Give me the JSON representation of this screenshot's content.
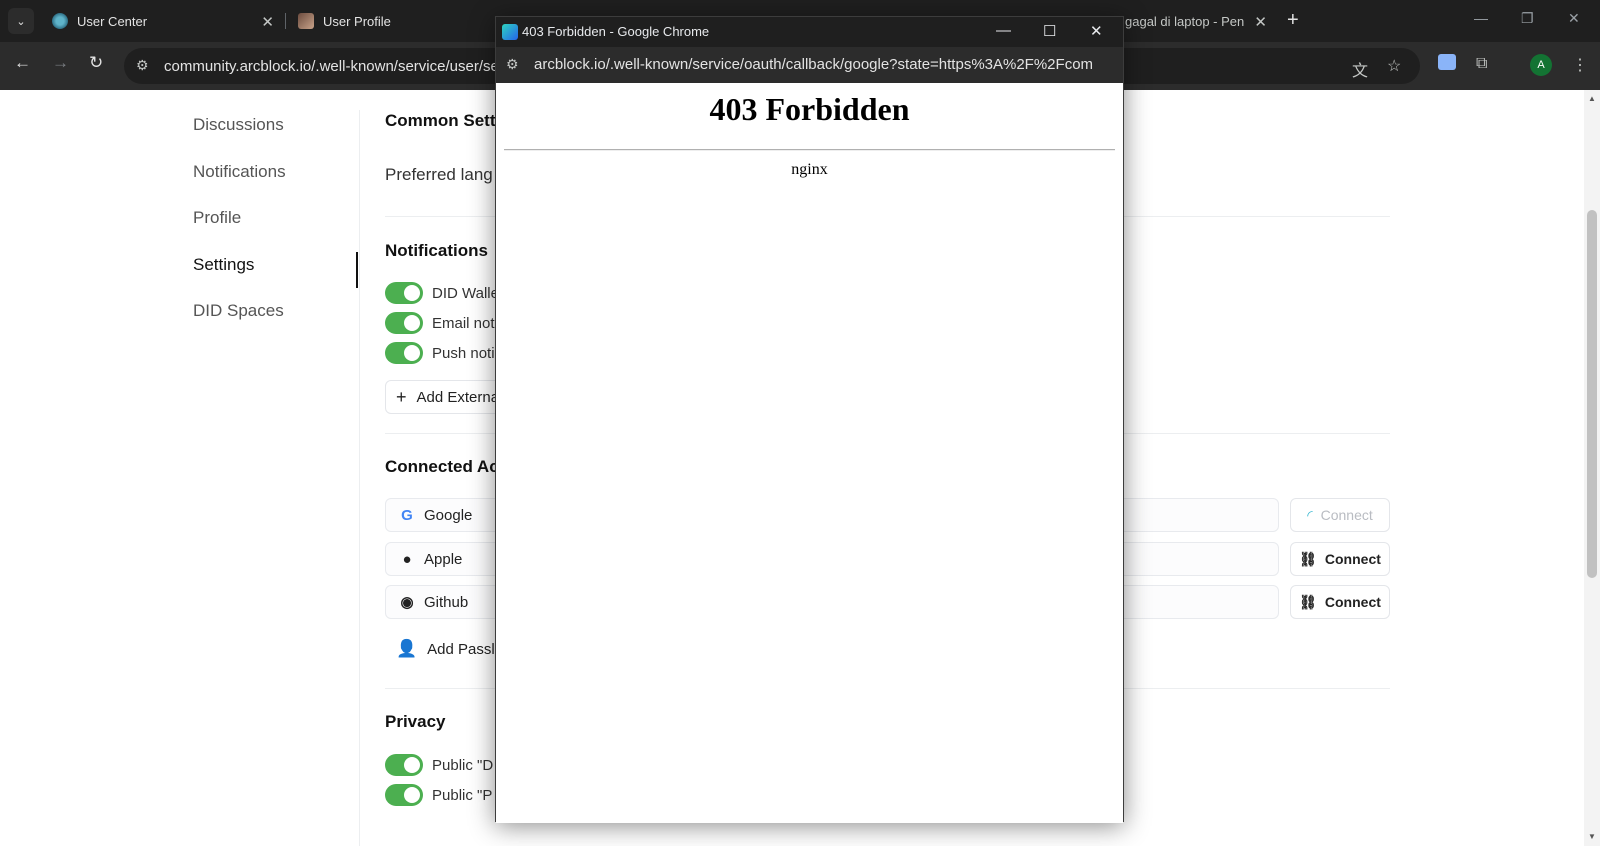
{
  "browser": {
    "tabs": [
      {
        "title": "User Center"
      },
      {
        "title": "User Profile"
      },
      {
        "title": "gagal di laptop - Pen"
      }
    ],
    "address_url": "community.arcblock.io/.well-known/service/user/se",
    "avatar_letter": "A"
  },
  "sidebar": {
    "items": [
      {
        "label": "Discussions"
      },
      {
        "label": "Notifications"
      },
      {
        "label": "Profile"
      },
      {
        "label": "Settings"
      },
      {
        "label": "DID Spaces"
      }
    ],
    "active": "Settings"
  },
  "settings": {
    "common_title": "Common Sett",
    "preferred_language": "Preferred lang",
    "notifications_title": "Notifications",
    "notification_toggles": [
      {
        "label": "DID Walle",
        "on": true
      },
      {
        "label": "Email not",
        "on": true
      },
      {
        "label": "Push noti",
        "on": true
      }
    ],
    "add_external": "Add Externa",
    "connected_title": "Connected Ac",
    "accounts": [
      {
        "name": "Google",
        "icon": "google-icon",
        "action": "Connect",
        "loading": true
      },
      {
        "name": "Apple",
        "icon": "apple-icon",
        "action": "Connect",
        "loading": false
      },
      {
        "name": "Github",
        "icon": "github-icon",
        "action": "Connect",
        "loading": false
      }
    ],
    "add_passkey": "Add Passl",
    "privacy_title": "Privacy",
    "privacy_toggles": [
      {
        "label": "Public \"D",
        "on": true
      },
      {
        "label": "Public \"P",
        "on": true
      }
    ]
  },
  "popup": {
    "window_title": "403 Forbidden - Google Chrome",
    "url": "arcblock.io/.well-known/service/oauth/callback/google?state=https%3A%2F%2Fcomm...",
    "heading": "403 Forbidden",
    "server": "nginx"
  },
  "colors": {
    "toggle_on": "#4caf50",
    "chrome_dark": "#1f1f1f",
    "toolbar_dark": "#2c2c2c"
  }
}
